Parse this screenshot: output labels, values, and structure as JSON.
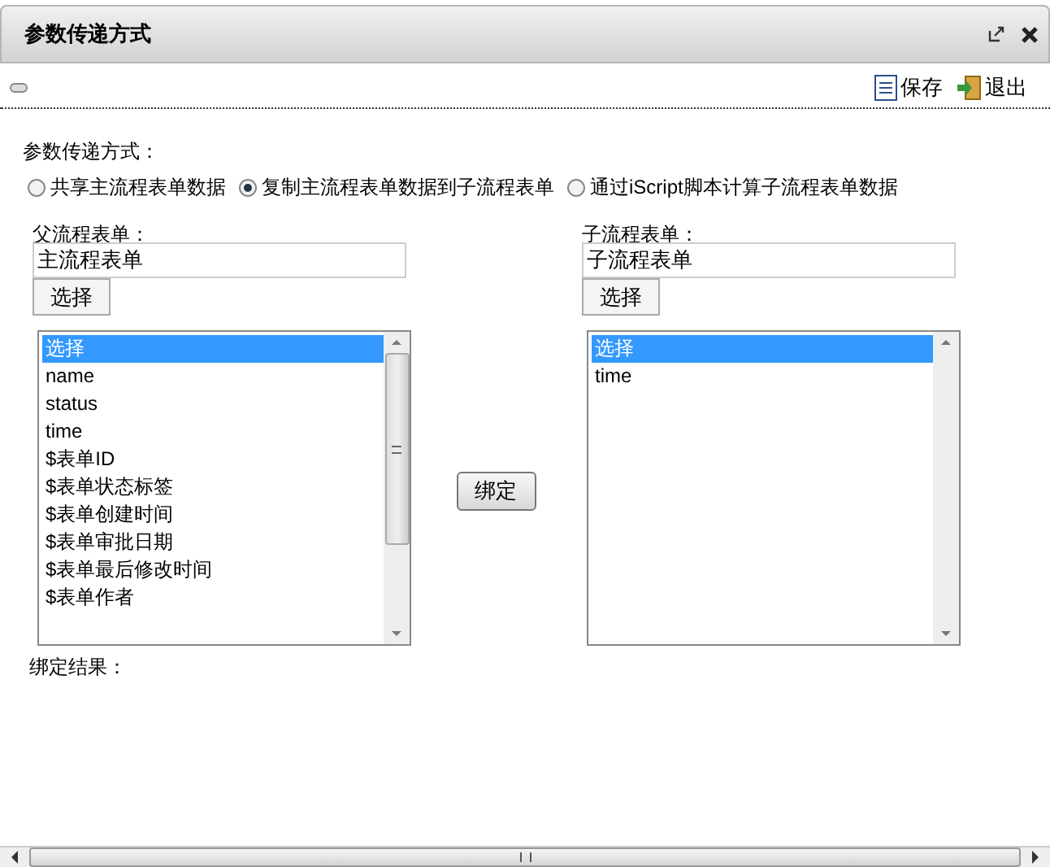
{
  "window": {
    "title": "参数传递方式"
  },
  "toolbar": {
    "buttons": [
      {
        "label": "保存",
        "kind": "save"
      },
      {
        "label": "退出",
        "kind": "exit"
      }
    ]
  },
  "mode": {
    "label": "参数传递方式：",
    "options": [
      {
        "label": "共享主流程表单数据",
        "selected": false
      },
      {
        "label": "复制主流程表单数据到子流程表单",
        "selected": true
      },
      {
        "label": "通过iScript脚本计算子流程表单数据",
        "selected": false
      }
    ]
  },
  "parent": {
    "label": "父流程表单：",
    "value": "主流程表单",
    "button": "选择",
    "items": [
      {
        "label": "选择",
        "selected": true
      },
      {
        "label": "name",
        "selected": false
      },
      {
        "label": "status",
        "selected": false
      },
      {
        "label": "time",
        "selected": false
      },
      {
        "label": "$表单ID",
        "selected": false
      },
      {
        "label": "$表单状态标签",
        "selected": false
      },
      {
        "label": "$表单创建时间",
        "selected": false
      },
      {
        "label": "$表单审批日期",
        "selected": false
      },
      {
        "label": "$表单最后修改时间",
        "selected": false
      },
      {
        "label": "$表单作者",
        "selected": false
      }
    ]
  },
  "bind_button": "绑定",
  "child": {
    "label": "子流程表单：",
    "value": "子流程表单",
    "button": "选择",
    "items": [
      {
        "label": "选择",
        "selected": true
      },
      {
        "label": "time",
        "selected": false
      }
    ]
  },
  "result": {
    "label": "绑定结果："
  }
}
